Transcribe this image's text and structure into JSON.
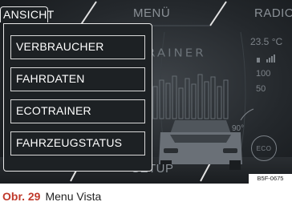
{
  "background": {
    "tabs": {
      "menu": "MENÜ",
      "radio": "RADIO",
      "setup": "SETUP"
    },
    "brand_text": "RAINER",
    "temperature": "23.5 °C",
    "scale": {
      "high": "100",
      "low": "50"
    },
    "steering_angle": "90°",
    "eco_label": "ECO"
  },
  "popup": {
    "tab_label": "ANSICHT",
    "items": [
      {
        "label": "VERBRAUCHER"
      },
      {
        "label": "FAHRDATEN"
      },
      {
        "label": "ECOTRAINER"
      },
      {
        "label": "FAHRZEUGSTATUS"
      }
    ]
  },
  "figure": {
    "code": "B5F-0675",
    "number": "Obr. 29",
    "title": "Menu Vista"
  },
  "colors": {
    "caption_number": "#c0392b",
    "menu_border": "#e8e8e8",
    "screen_bg": "#24282c"
  }
}
